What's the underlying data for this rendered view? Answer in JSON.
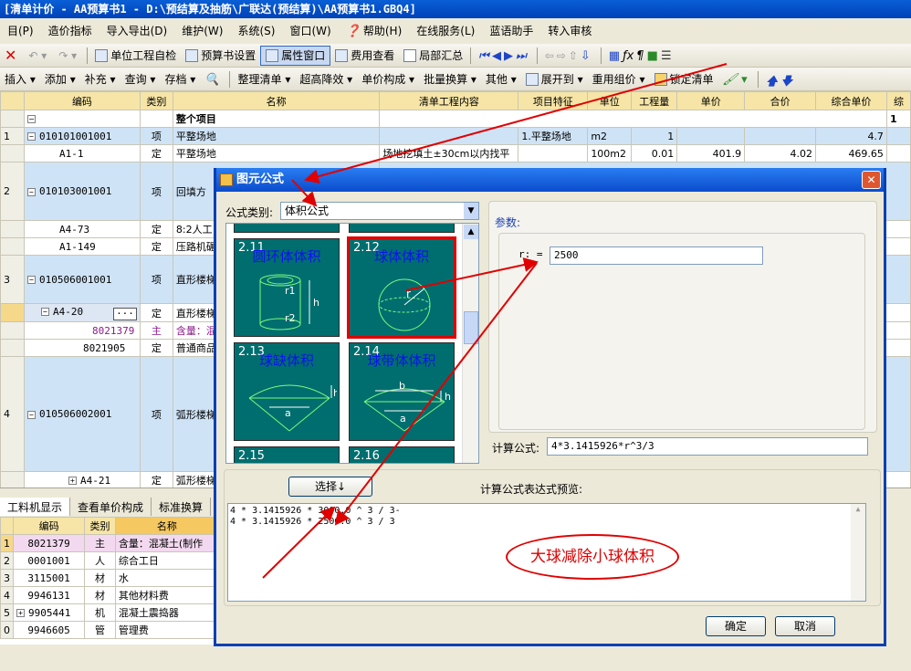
{
  "title": "[清单计价 - AA预算书1 - D:\\预结算及抽筋\\广联达(预结算)\\AA预算书1.GBQ4]",
  "menu": [
    "目(P)",
    "造价指标",
    "导入导出(D)",
    "维护(W)",
    "系统(S)",
    "窗口(W)",
    "帮助(H)",
    "蓝语助手",
    "转入审核"
  ],
  "menu_extra": "在线服务(L)",
  "toolbar1": {
    "items": [
      "单位工程自检",
      "预算书设置",
      "属性窗口",
      "费用查看",
      "局部汇总"
    ]
  },
  "toolbar2": {
    "items": [
      "插入",
      "添加",
      "补充",
      "查询",
      "存档",
      "整理清单",
      "超高降效",
      "单价构成",
      "批量换算",
      "其他",
      "展开到",
      "重用组价",
      "锁定清单"
    ]
  },
  "grid": {
    "headers": [
      "编码",
      "类别",
      "名称",
      "清单工程内容",
      "项目特征",
      "单位",
      "工程量",
      "单价",
      "合价",
      "综合单价",
      "综"
    ],
    "rows": [
      {
        "no": "",
        "code": "",
        "type": "",
        "name": "整个项目",
        "content": "",
        "feature": "",
        "unit": "",
        "qty": "",
        "price": "",
        "total": "",
        "unitprice": "",
        "x": "1"
      },
      {
        "no": "1",
        "code": "010101001001",
        "type": "项",
        "name": "平整场地",
        "content": "",
        "feature": "1.平整场地",
        "unit": "m2",
        "qty": "1",
        "price": "",
        "total": "",
        "unitprice": "4.7",
        "x": ""
      },
      {
        "no": "",
        "code": "A1-1",
        "type": "定",
        "name": "平整场地",
        "content": "场地挖填土±30cm以内找平",
        "feature": "",
        "unit": "100m2",
        "qty": "0.01",
        "price": "401.9",
        "total": "4.02",
        "unitprice": "469.65",
        "x": ""
      },
      {
        "no": "2",
        "code": "010103001001",
        "type": "项",
        "name": "回填方"
      },
      {
        "no": "",
        "code": "A4-73",
        "type": "定",
        "name": "8:2人工"
      },
      {
        "no": "",
        "code": "A1-149",
        "type": "定",
        "name": "压路机碾"
      },
      {
        "no": "3",
        "code": "010506001001",
        "type": "项",
        "name": "直形楼梯"
      },
      {
        "no": "",
        "code": "A4-20",
        "type": "定",
        "name": "直形楼梯"
      },
      {
        "no": "",
        "code": "8021379",
        "type": "主",
        "name": "含量：混"
      },
      {
        "no": "",
        "code": "8021905",
        "type": "定",
        "name": "普通商品"
      },
      {
        "no": "4",
        "code": "010506002001",
        "type": "项",
        "name": "弧形楼梯"
      },
      {
        "no": "",
        "code": "A4-21",
        "type": "定",
        "name": "弧形楼梯"
      }
    ]
  },
  "bottom_tabs": [
    "工料机显示",
    "查看单价构成",
    "标准换算"
  ],
  "bottom_grid": {
    "headers": [
      "编码",
      "类别",
      "名称"
    ],
    "rows": [
      {
        "no": "1",
        "code": "8021379",
        "type": "主",
        "name": "含量：混凝土(制作"
      },
      {
        "no": "2",
        "code": "0001001",
        "type": "人",
        "name": "综合工日"
      },
      {
        "no": "3",
        "code": "3115001",
        "type": "材",
        "name": "水"
      },
      {
        "no": "4",
        "code": "9946131",
        "type": "材",
        "name": "其他材料费"
      },
      {
        "no": "5",
        "code": "9905441",
        "type": "机",
        "name": "混凝土震捣器"
      },
      {
        "no": "0",
        "code": "9946605",
        "type": "管",
        "name": "管理费"
      }
    ]
  },
  "dialog": {
    "title": "图元公式",
    "category_label": "公式类别:",
    "category_value": "体积公式",
    "params_label": "参数:",
    "param_name": "r:  =",
    "param_value": "2500",
    "formula_label": "计算公式:",
    "formula_value": "4*3.1415926*r^3/3",
    "select_button": "选择↓",
    "preview_label": "计算公式表达式预览:",
    "preview_lines": [
      "4 * 3.1415926 * 3000.0 ^ 3 / 3-",
      "4 * 3.1415926 * 2500.0 ^ 3 / 3"
    ],
    "annotation": "大球减除小球体积",
    "ok": "确定",
    "cancel": "取消",
    "gallery": [
      {
        "num": "2.11",
        "name": "圆环体体积"
      },
      {
        "num": "2.12",
        "name": "球体体积"
      },
      {
        "num": "2.13",
        "name": "球缺体积"
      },
      {
        "num": "2.14",
        "name": "球带体体积"
      },
      {
        "num": "2.15",
        "name": ""
      },
      {
        "num": "2.16",
        "name": ""
      }
    ],
    "shape_labels": {
      "r1": "r1",
      "r2": "r2",
      "h": "h",
      "r": "r",
      "a": "a",
      "b": "b"
    }
  }
}
